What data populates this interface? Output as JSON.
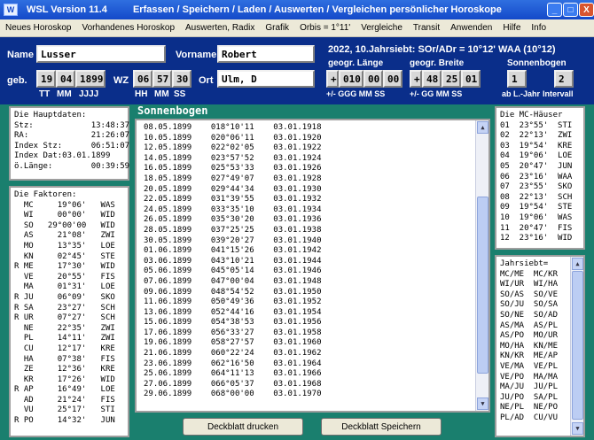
{
  "window": {
    "title_parts": [
      "WSL Version 11.4",
      "Erfassen / Speichern / Laden / Auswerten / Vergleichen persönlicher Horoskope"
    ],
    "minimize": "_",
    "maximize": "□",
    "close": "X"
  },
  "menu": [
    "Neues Horoskop",
    "Vorhandenes Horoskop",
    "Auswerten, Radix",
    "Grafik",
    "Orbis = 1°11'",
    "Vergleiche",
    "Transit",
    "Anwenden",
    "Hilfe",
    "Info"
  ],
  "person": {
    "name_label": "Name",
    "name_value": "Lusser",
    "vorname_label": "Vorname",
    "vorname_value": "Robert",
    "geb_label": "geb.",
    "tt": "19",
    "mm": "04",
    "jjjj": "1899",
    "tt_label": "TT",
    "mm_label": "MM",
    "jjjj_label": "JJJJ",
    "wz_label": "WZ",
    "hh": "06",
    "min": "57",
    "ss": "30",
    "hh_label": "HH",
    "min_label": "MM",
    "ss_label": "SS",
    "ort_label": "Ort",
    "ort_value": "Ulm, D"
  },
  "jahrsiebt_header": "2022, 10.Jahrsiebt: SOr/ADr = 10°12' WAA (10°12)",
  "geo": {
    "laenge_label": "geogr. Länge",
    "laenge_sign": "+",
    "laenge_ggg": "010",
    "laenge_mm": "00",
    "laenge_ss": "00",
    "laenge_sub": "+/-  GGG  MM  SS",
    "breite_label": "geogr. Breite",
    "breite_sign": "+",
    "breite_gg": "48",
    "breite_mm": "25",
    "breite_ss": "01",
    "breite_sub": "+/-  GG  MM  SS"
  },
  "sonnenbogen": {
    "label": "Sonnenbogen",
    "ab_value": "1",
    "intervall_value": "2",
    "ab_label": "ab L.-Jahr",
    "intervall_label": "Intervall"
  },
  "hauptdaten": [
    "Die Hauptdaten:",
    "Stz:            13:48:37",
    "RA:             21:26:07",
    "Index Stz:      06:51:07",
    "Index Dat:03.01.1899",
    "ö.Länge:        00:39:59"
  ],
  "faktoren": [
    "Die Faktoren:",
    "  MC     19°06'   WAS",
    "  WI     00°00'   WID",
    "  SO   29°00'00   WID",
    "  AS     21°08'   ZWI",
    "  MO     13°35'   LOE",
    "  KN     02°45'   STE",
    "R ME     17°30'   WID",
    "  VE     20°55'   FIS",
    "  MA     01°31'   LOE",
    "R JU     06°09'   SKO",
    "R SA     23°27'   SCH",
    "R UR     07°27'   SCH",
    "  NE     22°35'   ZWI",
    "  PL     14°11'   ZWI",
    "  CU     12°17'   KRE",
    "  HA     07°38'   FIS",
    "  ZE     12°36'   KRE",
    "  KR     17°26'   WID",
    "R AP     16°49'   LOE",
    "  AD     21°24'   FIS",
    "  VU     25°17'   STI",
    "R PO     14°32'   JUN"
  ],
  "sonnenbogen_title": "Sonnenbogen",
  "sonnenbogen_rows": [
    "08.05.1899    018°10'11    03.01.1918",
    "10.05.1899    020°06'11    03.01.1920",
    "12.05.1899    022°02'05    03.01.1922",
    "14.05.1899    023°57'52    03.01.1924",
    "16.05.1899    025°53'33    03.01.1926",
    "18.05.1899    027°49'07    03.01.1928",
    "20.05.1899    029°44'34    03.01.1930",
    "22.05.1899    031°39'55    03.01.1932",
    "24.05.1899    033°35'10    03.01.1934",
    "26.05.1899    035°30'20    03.01.1936",
    "28.05.1899    037°25'25    03.01.1938",
    "30.05.1899    039°20'27    03.01.1940",
    "01.06.1899    041°15'26    03.01.1942",
    "03.06.1899    043°10'21    03.01.1944",
    "05.06.1899    045°05'14    03.01.1946",
    "07.06.1899    047°00'04    03.01.1948",
    "09.06.1899    048°54'52    03.01.1950",
    "11.06.1899    050°49'36    03.01.1952",
    "13.06.1899    052°44'16    03.01.1954",
    "15.06.1899    054°38'53    03.01.1956",
    "17.06.1899    056°33'27    03.01.1958",
    "19.06.1899    058°27'57    03.01.1960",
    "21.06.1899    060°22'24    03.01.1962",
    "23.06.1899    062°16'50    03.01.1964",
    "25.06.1899    064°11'13    03.01.1966",
    "27.06.1899    066°05'37    03.01.1968",
    "29.06.1899    068°00'00    03.01.1970"
  ],
  "haeuser": [
    "Die MC-Häuser",
    "01  23°55'  STI",
    "02  22°13'  ZWI",
    "03  19°54'  KRE",
    "04  19°06'  LOE",
    "05  20°47'  JUN",
    "06  23°16'  WAA",
    "07  23°55'  SKO",
    "08  22°13'  SCH",
    "09  19°54'  STE",
    "10  19°06'  WAS",
    "11  20°47'  FIS",
    "12  23°16'  WID"
  ],
  "jahrsiebt": [
    "Jahrsiebt=",
    "MC/ME  MC/KR",
    "WI/UR  WI/HA",
    "SO/AS  SO/VE",
    "SO/JU  SO/SA",
    "SO/NE  SO/AD",
    "AS/MA  AS/PL",
    "AS/PO  MO/UR",
    "MO/HA  KN/ME",
    "KN/KR  ME/AP",
    "VE/MA  VE/PL",
    "VE/PO  MA/MA",
    "MA/JU  JU/PL",
    "JU/PO  SA/PL",
    "NE/PL  NE/PO",
    "PL/AD  CU/VU"
  ],
  "buttons": {
    "deckblatt_drucken": "Deckblatt drucken",
    "deckblatt_speichern": "Deckblatt Speichern"
  },
  "icons": {
    "scroll_up": "▲",
    "scroll_down": "▼"
  }
}
